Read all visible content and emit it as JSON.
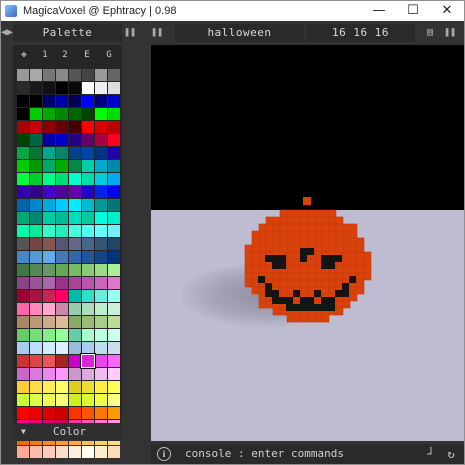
{
  "window": {
    "title": "MagicaVoxel @ Ephtracy | 0.98",
    "minimize": "—",
    "maximize": "☐",
    "close": "✕"
  },
  "toolbar": {
    "left_icons": [
      "◀▶",
      "❚❚"
    ],
    "palette_title": "Palette",
    "left_end_icon": "❚❚",
    "file_name": "halloween",
    "dimensions": "16  16  16",
    "right_icons": [
      "▤",
      "❚❚"
    ]
  },
  "palette": {
    "tabs": [
      "✥",
      "1",
      "2",
      "E",
      "G"
    ],
    "footer_label": "Color",
    "footer_arrow": "▼",
    "selected_index": 181,
    "colors": [
      "#999999",
      "#a8a8a8",
      "#777777",
      "#888888",
      "#555555",
      "#444444",
      "#999999",
      "#666666",
      "#2a2a2a",
      "#1a1a1a",
      "#111111",
      "#000000",
      "#0a0a0a",
      "#ffffff",
      "#eeeeee",
      "#dddddd",
      "#000000",
      "#000000",
      "#00006a",
      "#0000aa",
      "#00005a",
      "#0000ff",
      "#000080",
      "#0000cc",
      "#000000",
      "#00cc00",
      "#00aa00",
      "#008800",
      "#006600",
      "#004400",
      "#00ff00",
      "#00dd00",
      "#aa0000",
      "#cc0000",
      "#880000",
      "#660000",
      "#440000",
      "#ff0000",
      "#dd0000",
      "#bb0000",
      "#004400",
      "#006644",
      "#0000aa",
      "#0000cc",
      "#220088",
      "#660066",
      "#aa0044",
      "#ff0022",
      "#00aa44",
      "#007733",
      "#00aa88",
      "#008866",
      "#004488",
      "#0044aa",
      "#003388",
      "#2200aa",
      "#00cc00",
      "#009900",
      "#00aa66",
      "#00aa00",
      "#008844",
      "#00ccaa",
      "#00aacc",
      "#0088aa",
      "#00ff44",
      "#00cc33",
      "#00ff88",
      "#00dd77",
      "#00ffcc",
      "#00ddaa",
      "#00ccdd",
      "#00aaee",
      "#3300aa",
      "#330088",
      "#4400cc",
      "#550099",
      "#6600aa",
      "#2200cc",
      "#0022ee",
      "#0000ee",
      "#0066aa",
      "#0088cc",
      "#00aadd",
      "#00ccff",
      "#00eeff",
      "#00bbcc",
      "#009999",
      "#007777",
      "#00aa77",
      "#008877",
      "#00ccaa",
      "#00bb99",
      "#00ddbb",
      "#00cc99",
      "#00ffdd",
      "#00eecc",
      "#00ffaa",
      "#00ee99",
      "#33ffcc",
      "#22eebb",
      "#44ffdd",
      "#55ffee",
      "#66ffff",
      "#77eeff",
      "#555555",
      "#774444",
      "#885555",
      "#555577",
      "#666688",
      "#446688",
      "#335577",
      "#224466",
      "#4488cc",
      "#5599dd",
      "#66aaee",
      "#4477bb",
      "#3366aa",
      "#225599",
      "#114488",
      "#003377",
      "#447744",
      "#558855",
      "#669966",
      "#66aa55",
      "#77bb66",
      "#88cc77",
      "#99dd88",
      "#aaee99",
      "#884488",
      "#995599",
      "#aa66aa",
      "#993388",
      "#aa4499",
      "#bb55aa",
      "#cc66bb",
      "#dd77cc",
      "#990033",
      "#aa1144",
      "#cc2255",
      "#ff0066",
      "#00bbaa",
      "#33ddcc",
      "#66eedd",
      "#99ffee",
      "#ff66aa",
      "#ff88bb",
      "#ffaacc",
      "#cc88aa",
      "#99ccaa",
      "#aaddbb",
      "#bbeecc",
      "#cceedd",
      "#aa8866",
      "#bb9977",
      "#ccaa88",
      "#ddbb99",
      "#88aa66",
      "#99bb77",
      "#aacc88",
      "#bbdd99",
      "#66cc66",
      "#77dd77",
      "#88ee88",
      "#99ff99",
      "#66ccaa",
      "#aaffcc",
      "#bbffdd",
      "#ccffee",
      "#aaccee",
      "#bbddff",
      "#cceeff",
      "#ddeeff",
      "#99bbdd",
      "#aaccee",
      "#bbddee",
      "#ccddee",
      "#cc3333",
      "#dd4444",
      "#ee5555",
      "#aa2222",
      "#cc00cc",
      "#dd22dd",
      "#ee44ee",
      "#ff66ff",
      "#cc66cc",
      "#dd77dd",
      "#ee88ee",
      "#ff99ff",
      "#cc99cc",
      "#ddaadd",
      "#eebbee",
      "#ffccff",
      "#ffcc33",
      "#ffdd44",
      "#ffee55",
      "#ffff66",
      "#ddcc22",
      "#eedd33",
      "#ffee44",
      "#ffff55",
      "#ccff33",
      "#ddff44",
      "#eeff55",
      "#ffff77",
      "#ccee22",
      "#ddff33",
      "#eeff44",
      "#ffff88",
      "#ff0000",
      "#ee0000",
      "#dd0000",
      "#cc0000",
      "#ff3300",
      "#ff5500",
      "#ff7700",
      "#ff9900",
      "#ff0088",
      "#ee0077",
      "#dd0066",
      "#cc0055",
      "#ff33aa",
      "#ff55bb",
      "#ff77cc",
      "#ff99dd",
      "#ff6600",
      "#ff7711",
      "#ff8822",
      "#ff9933",
      "#ffaa44",
      "#ffbb55",
      "#ffcc66",
      "#ffdd77",
      "#ffaa99",
      "#ffbbaa",
      "#ffccbb",
      "#ffddcc",
      "#ffeedd",
      "#ffffee",
      "#ffeecc",
      "#ffddbb"
    ]
  },
  "viewport": {
    "sky_color": "#000000",
    "floor_color": "#bdbcd1",
    "pumpkin_color": "#ff5a1f",
    "pumpkin_dark": "#d9420c",
    "face_color": "#141414"
  },
  "console": {
    "info_icon": "i",
    "text": "console : enter commands",
    "right_icons": [
      "┘",
      "↻"
    ]
  }
}
